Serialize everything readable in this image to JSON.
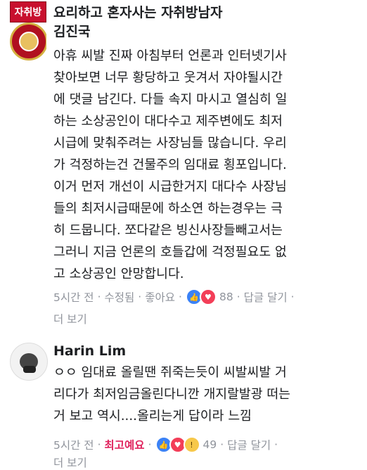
{
  "comment1": {
    "avatar_tag": "자취방",
    "group_name": "요리하고 혼자사는 자취방남자",
    "author": "김진국",
    "lines": [
      "아휴 씨발 진짜 아침부터 언론과 인터넷기사",
      "찾아보면 너무 황당하고 웃겨서 자야될시간",
      "에 댓글 남긴다. 다들 속지 마시고 열심히 일",
      "하는 소상공인이 대다수고 제주변에도 최저",
      "시급에 맞춰주려는 사장님들 많습니다. 우리",
      "가 걱정하는건 건물주의 임대료 횡포입니다.",
      "이거 먼저 개선이 시급한거지 대다수 사장님",
      "들의 최저시급때문에 하소연 하는경우는 극",
      "히 드뭅니다. 쪼다같은 빙신사장들빼고서는",
      "그러니 지금 언론의 호들갑에 걱정필요도 없",
      "고 소상공인 안망합니다."
    ],
    "time": "5시간 전",
    "edited": "수정됨",
    "like_label": "좋아요",
    "reaction_count": "88",
    "reply_label": "답글 달기",
    "more_label": "더 보기"
  },
  "comment2": {
    "author": "Harin Lim",
    "lines": [
      "ㅇㅇ 임대료 올릴땐 쥐죽는듯이 씨발씨발 거",
      "리다가 최저임금올린다니깐 개지랄발광 떠는",
      "거 보고 역시....올리는게 답이라 느낌"
    ],
    "time": "5시간 전",
    "top_label": "최고예요",
    "reaction_count": "49",
    "reply_label": "답글 달기",
    "more_label": "더 보기"
  },
  "separator": "·",
  "icons": {
    "like": "like-icon",
    "love": "love-icon",
    "wow": "wow-icon"
  },
  "colors": {
    "meta": "#90949c",
    "like": "#3b82f6",
    "love": "#f33e58",
    "top": "#e0245e"
  }
}
